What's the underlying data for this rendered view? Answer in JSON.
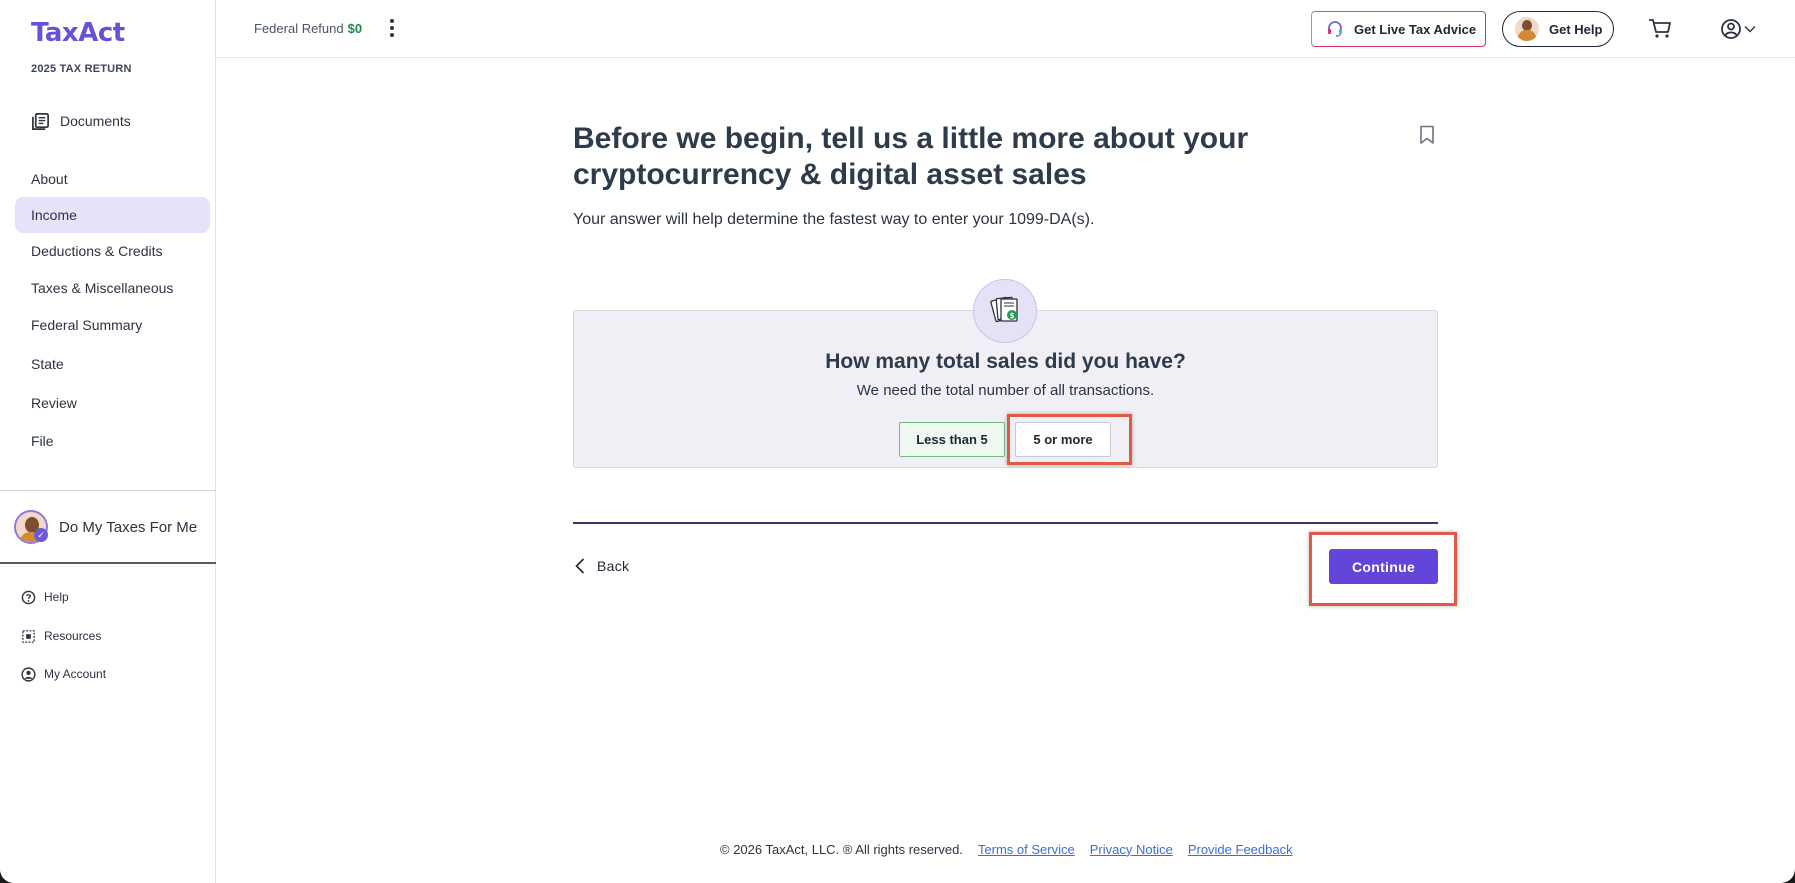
{
  "app": {
    "logo": "TaxAct",
    "year_label": "2025 TAX RETURN"
  },
  "sidebar": {
    "documents_label": "Documents",
    "items": [
      {
        "label": "About",
        "active": false
      },
      {
        "label": "Income",
        "active": true
      },
      {
        "label": "Deductions & Credits",
        "active": false
      },
      {
        "label": "Taxes & Miscellaneous",
        "active": false
      },
      {
        "label": "Federal Summary",
        "active": false
      },
      {
        "label": "State",
        "active": false
      },
      {
        "label": "Review",
        "active": false
      },
      {
        "label": "File",
        "active": false
      }
    ],
    "do_my_taxes_label": "Do My Taxes For Me",
    "footer_links": [
      {
        "label": "Help",
        "icon": "question-circle-icon"
      },
      {
        "label": "Resources",
        "icon": "resources-icon"
      },
      {
        "label": "My Account",
        "icon": "user-circle-icon"
      }
    ]
  },
  "header": {
    "refund_label": "Federal Refund",
    "refund_amount": "$0",
    "live_advice_label": "Get Live Tax Advice",
    "get_help_label": "Get Help"
  },
  "main": {
    "title": "Before we begin, tell us a little more about your cryptocurrency & digital asset sales",
    "subtitle": "Your answer will help determine the fastest way to enter your 1099-DA(s).",
    "question": "How many total sales did you have?",
    "hint": "We need the total number of all transactions.",
    "options": [
      "Less than 5",
      "5 or more"
    ],
    "back_label": "Back",
    "continue_label": "Continue"
  },
  "footer": {
    "copyright": "© 2026 TaxAct, LLC. ® All rights reserved.",
    "links": [
      "Terms of Service",
      "Privacy Notice",
      "Provide Feedback"
    ]
  },
  "colors": {
    "brand": "#6a4fd8",
    "primary_button": "#6346d9",
    "active_nav": "#e6e2fb",
    "refund": "#1d8a4b",
    "highlight": "#e05a4a"
  }
}
